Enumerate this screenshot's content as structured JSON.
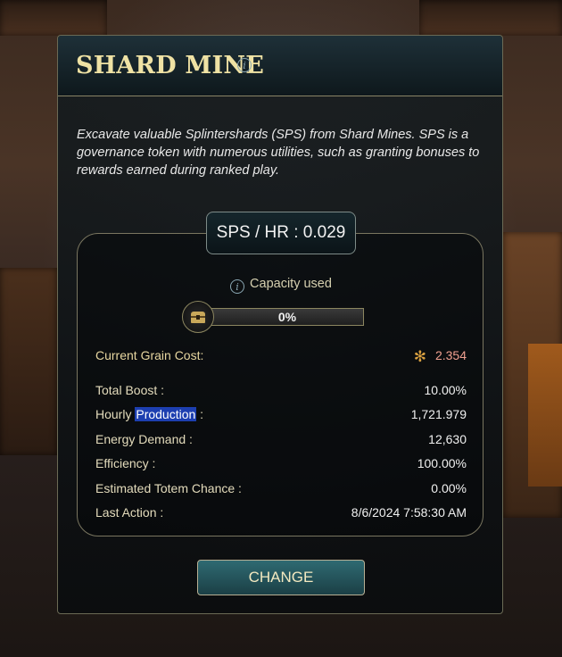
{
  "panel": {
    "title": "SHARD MINE",
    "description": "Excavate valuable Splintershards (SPS) from Shard Mines. SPS is a governance token with numerous utilities, such as granting bonuses to rewards earned during ranked play."
  },
  "sps_rate": "SPS / HR : 0.029",
  "capacity": {
    "label": "Capacity used",
    "percent_text": "0%",
    "fraction": 0
  },
  "grain_cost": {
    "label": "Current Grain Cost:",
    "value": "2.354"
  },
  "stats": [
    {
      "label": "Total Boost :",
      "value": "10.00%"
    },
    {
      "label_prefix": "Hourly ",
      "label_highlight": "Production",
      "label_suffix": " :",
      "value": "1,721.979"
    },
    {
      "label": "Energy Demand :",
      "value": "12,630"
    },
    {
      "label": "Efficiency :",
      "value": "100.00%"
    },
    {
      "label": "Estimated Totem Chance :",
      "value": "0.00%"
    },
    {
      "label": "Last Action :",
      "value": "8/6/2024 7:58:30 AM"
    }
  ],
  "change_button": "CHANGE",
  "icons": {
    "title_info": "info-icon",
    "capacity_info": "info-icon",
    "chest": "treasure-chest-icon",
    "grain": "wheat-icon"
  }
}
